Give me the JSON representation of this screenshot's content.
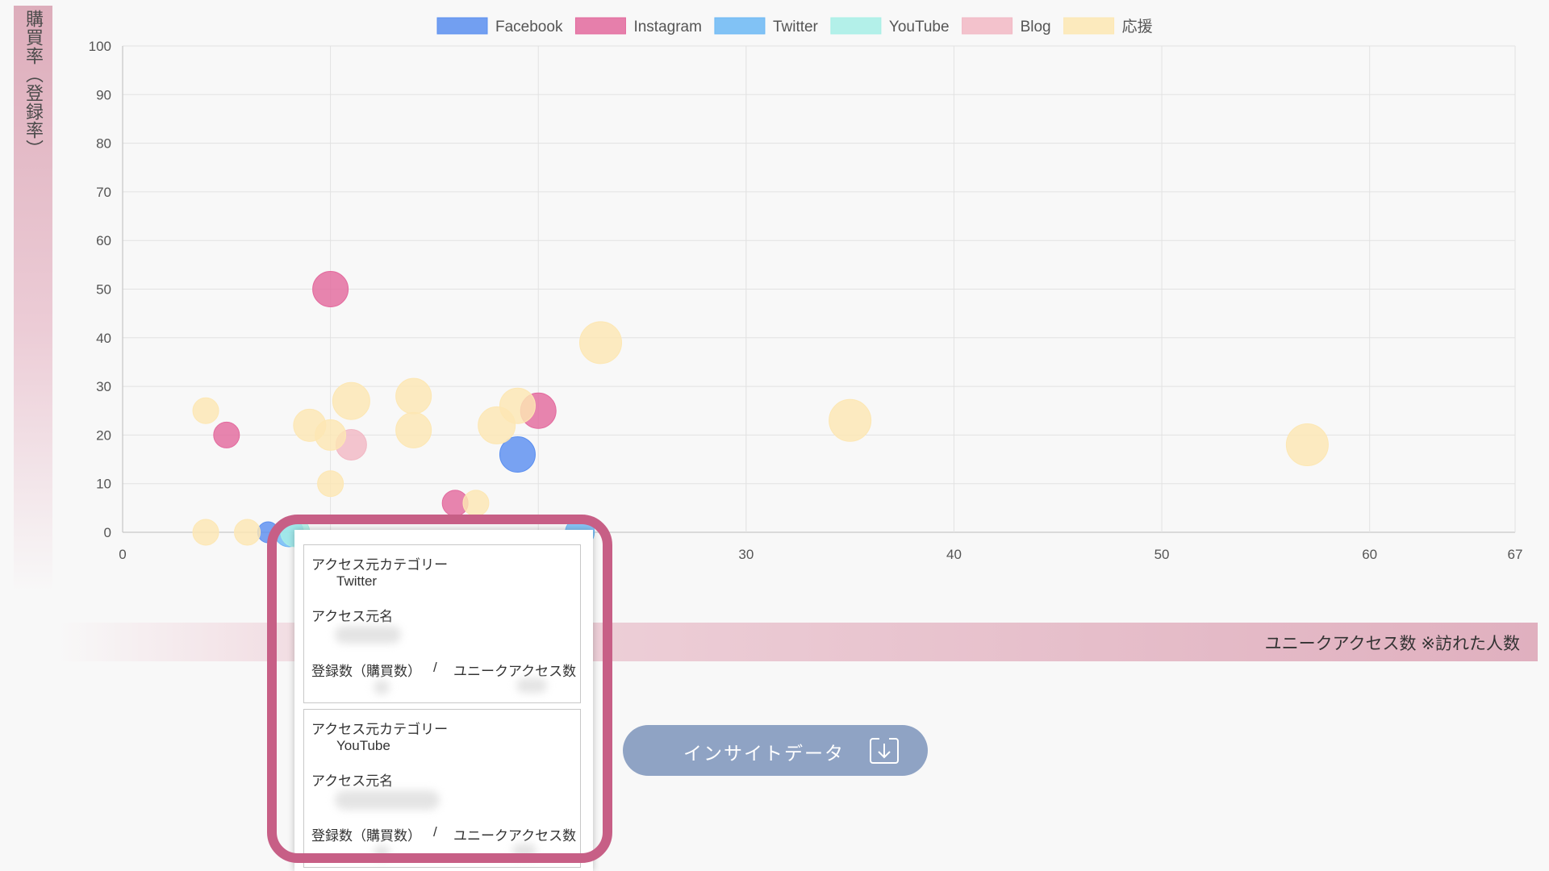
{
  "chart_data": {
    "type": "scatter",
    "xlabel": "ユニークアクセス数 ※訪れた人数",
    "ylabel": "購買率（登録率）",
    "xlim": [
      0,
      67
    ],
    "ylim": [
      0,
      100
    ],
    "x_ticks": [
      0,
      10,
      20,
      30,
      40,
      50,
      60,
      67
    ],
    "x_tick_labels": [
      "0",
      "",
      "",
      "30",
      "40",
      "50",
      "60",
      "67"
    ],
    "y_ticks": [
      0,
      10,
      20,
      30,
      40,
      50,
      60,
      70,
      80,
      90,
      100
    ],
    "grid": true,
    "legend_position": "top",
    "series": [
      {
        "name": "Facebook",
        "color": "#5b8ff0",
        "points": [
          {
            "x": 7,
            "y": 0
          },
          {
            "x": 19,
            "y": 16
          }
        ]
      },
      {
        "name": "Instagram",
        "color": "#e36a9e",
        "points": [
          {
            "x": 5,
            "y": 20
          },
          {
            "x": 10,
            "y": 50
          },
          {
            "x": 16,
            "y": 6
          },
          {
            "x": 20,
            "y": 25
          }
        ]
      },
      {
        "name": "Twitter",
        "color": "#6cb8f5",
        "points": [
          {
            "x": 8,
            "y": 0
          },
          {
            "x": 22,
            "y": 0
          }
        ]
      },
      {
        "name": "YouTube",
        "color": "#a7efe6",
        "points": [
          {
            "x": 8.3,
            "y": 0
          }
        ]
      },
      {
        "name": "Blog",
        "color": "#f2b8c4",
        "points": [
          {
            "x": 11,
            "y": 18
          }
        ]
      },
      {
        "name": "応援",
        "color": "#fde7b3",
        "points": [
          {
            "x": 4,
            "y": 25
          },
          {
            "x": 4,
            "y": 0
          },
          {
            "x": 6,
            "y": 0
          },
          {
            "x": 9,
            "y": 22
          },
          {
            "x": 10,
            "y": 20
          },
          {
            "x": 10,
            "y": 10
          },
          {
            "x": 11,
            "y": 27
          },
          {
            "x": 14,
            "y": 28
          },
          {
            "x": 14,
            "y": 21
          },
          {
            "x": 17,
            "y": 6
          },
          {
            "x": 18,
            "y": 22
          },
          {
            "x": 19,
            "y": 26
          },
          {
            "x": 23,
            "y": 39
          },
          {
            "x": 35,
            "y": 23
          },
          {
            "x": 57,
            "y": 18
          }
        ]
      }
    ]
  },
  "tooltip": {
    "cards": [
      {
        "category_label": "アクセス元カテゴリー",
        "category_value": "Twitter",
        "name_label": "アクセス元名",
        "ratio_left": "登録数（購買数）",
        "ratio_sep": "/",
        "ratio_right": "ユニークアクセス数"
      },
      {
        "category_label": "アクセス元カテゴリー",
        "category_value": "YouTube",
        "name_label": "アクセス元名",
        "ratio_left": "登録数（購買数）",
        "ratio_sep": "/",
        "ratio_right": "ユニークアクセス数"
      }
    ]
  },
  "insight_button": {
    "label": "インサイトデータ"
  },
  "colors": {
    "highlight": "#c75f86",
    "button": "#8fa3c4"
  }
}
